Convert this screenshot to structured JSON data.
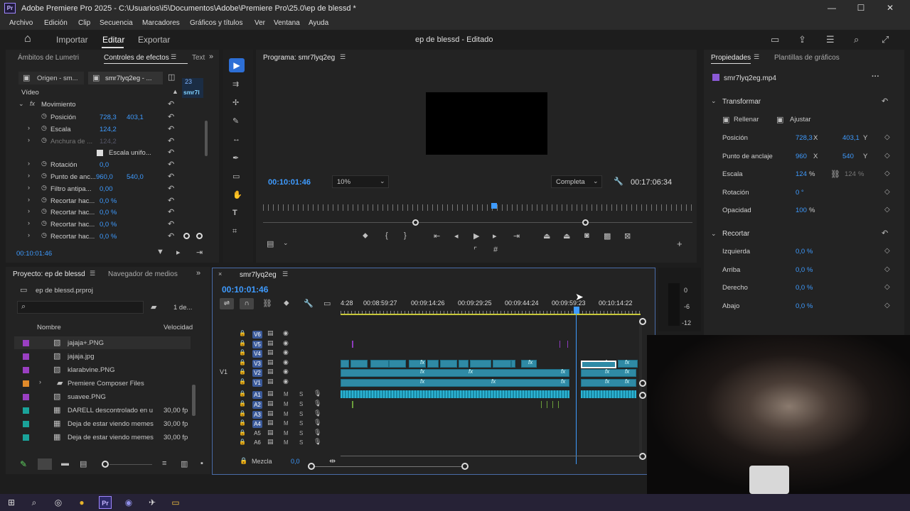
{
  "window": {
    "title": "Adobe Premiere Pro 2025 - C:\\Usuarios\\i5\\Documentos\\Adobe\\Premiere Pro\\25.0\\ep de blessd *",
    "app_badge": "Pr",
    "min": "—",
    "max": "☐",
    "close": "✕"
  },
  "menu": [
    "Archivo",
    "Edición",
    "Clip",
    "Secuencia",
    "Marcadores",
    "Gráficos y títulos",
    "Ver",
    "Ventana",
    "Ayuda"
  ],
  "header": {
    "home_icon": "⌂",
    "import": "Importar",
    "edit": "Editar",
    "export": "Exportar",
    "project_title": "ep de blessd - Editado"
  },
  "effects_panel": {
    "tabs": [
      "Ámbitos de Lumetri",
      "Controles de efectos",
      "Text"
    ],
    "source_tab": "Origen - sm...",
    "clip_tab": "smr7lyq2eg - ...",
    "video_label": "Vídeo",
    "mini_time": "23",
    "mini_clip": "smr7l",
    "motion": "Movimiento",
    "rows": [
      {
        "label": "Posición",
        "v1": "728,3",
        "v2": "403,1"
      },
      {
        "label": "Escala",
        "v1": "124,2",
        "v2": ""
      },
      {
        "label": "Anchura de ...",
        "v1": "124,2",
        "v2": ""
      },
      {
        "label": "Escala unifo...",
        "v1": "",
        "v2": ""
      },
      {
        "label": "Rotación",
        "v1": "0,0",
        "v2": ""
      },
      {
        "label": "Punto de anc...",
        "v1": "960,0",
        "v2": "540,0"
      },
      {
        "label": "Filtro antipa...",
        "v1": "0,00",
        "v2": ""
      },
      {
        "label": "Recortar hac...",
        "v1": "0,0 %",
        "v2": ""
      },
      {
        "label": "Recortar hac...",
        "v1": "0,0 %",
        "v2": ""
      },
      {
        "label": "Recortar hac...",
        "v1": "0,0 %",
        "v2": ""
      },
      {
        "label": "Recortar hac...",
        "v1": "0,0 %",
        "v2": ""
      }
    ],
    "timecode": "00:10:01:46"
  },
  "program": {
    "title": "Programa: smr7lyq2eg",
    "timecode": "00:10:01:46",
    "zoom": "10%",
    "quality": "Completa",
    "duration": "00:17:06:34"
  },
  "properties": {
    "tabs": [
      "Propiedades",
      "Plantillas de gráficos"
    ],
    "clip": "smr7lyq2eg.mp4",
    "transform": "Transformar",
    "fill": "Rellenar",
    "fit": "Ajustar",
    "rows": [
      {
        "label": "Posición",
        "v1": "728,3",
        "u1": "X",
        "v2": "403,1",
        "u2": "Y"
      },
      {
        "label": "Punto de anclaje",
        "v1": "960",
        "u1": "X",
        "v2": "540",
        "u2": "Y"
      },
      {
        "label": "Escala",
        "v1": "124",
        "u1": "%",
        "v2": "124",
        "u2": "%"
      },
      {
        "label": "Rotación",
        "v1": "0 °",
        "u1": "",
        "v2": "",
        "u2": ""
      },
      {
        "label": "Opacidad",
        "v1": "100",
        "u1": "%",
        "v2": "",
        "u2": ""
      }
    ],
    "crop": "Recortar",
    "crop_rows": [
      {
        "label": "Izquierda",
        "v": "0,0 %"
      },
      {
        "label": "Arriba",
        "v": "0,0 %"
      },
      {
        "label": "Derecho",
        "v": "0,0 %"
      },
      {
        "label": "Abajo",
        "v": "0,0 %"
      }
    ]
  },
  "project": {
    "tabs": [
      "Proyecto: ep de blessd",
      "Navegador de medios"
    ],
    "file": "ep de blessd.prproj",
    "count": "1 de...",
    "col_name": "Nombre",
    "col_rate": "Velocidad",
    "items": [
      {
        "name": "jajaja+.PNG",
        "rate": "",
        "color": "#9a3fc2"
      },
      {
        "name": "jajaja.jpg",
        "rate": "",
        "color": "#9a3fc2"
      },
      {
        "name": "klarabvine.PNG",
        "rate": "",
        "color": "#9a3fc2"
      },
      {
        "name": "Premiere Composer Files",
        "rate": "",
        "color": "#e08a2a"
      },
      {
        "name": "suavee.PNG",
        "rate": "",
        "color": "#9a3fc2"
      },
      {
        "name": "DARELL descontrolado en u",
        "rate": "30,00 fp",
        "color": "#1aa39a"
      },
      {
        "name": "Deja de estar viendo memes",
        "rate": "30,00 fp",
        "color": "#1aa39a"
      },
      {
        "name": "Deja de estar viendo memes",
        "rate": "30,00 fp",
        "color": "#1aa39a"
      }
    ]
  },
  "timeline": {
    "seq": "smr7lyq2eg",
    "timecode": "00:10:01:46",
    "ruler": [
      "4:28",
      "00:08:59:27",
      "00:09:14:26",
      "00:09:29:25",
      "00:09:44:24",
      "00:09:59:23",
      "00:10:14:22"
    ],
    "video_tracks": [
      "V6",
      "V5",
      "V4",
      "V3",
      "V2",
      "V1"
    ],
    "audio_tracks": [
      "A1",
      "A2",
      "A3",
      "A4",
      "A5",
      "A6"
    ],
    "v1_label": "V1",
    "mix": "Mezcla",
    "mix_val": "0,0",
    "meter": [
      "0",
      "-6",
      "-12"
    ]
  },
  "taskbar": [
    "⊞",
    "⌕",
    "◎",
    "●",
    "Pr",
    "◉",
    "✈",
    "▭"
  ]
}
